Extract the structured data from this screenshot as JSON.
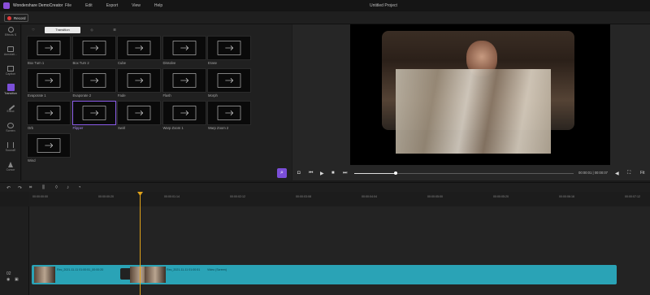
{
  "app": {
    "name": "Wondershare DemoCreator",
    "project_title": "Untitled Project"
  },
  "menu": [
    "File",
    "Edit",
    "Export",
    "View",
    "Help"
  ],
  "record_label": "Record",
  "sidebar": [
    {
      "label": "Effects S",
      "icon": "effects-icon"
    },
    {
      "label": "Annotati...",
      "icon": "annotation-icon"
    },
    {
      "label": "Caption",
      "icon": "caption-icon"
    },
    {
      "label": "Transition",
      "icon": "transition-icon",
      "active": true
    },
    {
      "label": "Effect",
      "icon": "effect-icon"
    },
    {
      "label": "Screen",
      "icon": "screen-icon"
    },
    {
      "label": "SoundE",
      "icon": "sound-icon"
    },
    {
      "label": "Cursor",
      "icon": "cursor-icon"
    }
  ],
  "library_tabs": [
    "",
    "Transition",
    "",
    ""
  ],
  "transitions": [
    "Box Turn 1",
    "Box Turn 2",
    "Cube",
    "Dissolve",
    "Erase",
    "Evaporate 1",
    "Evaporate 2",
    "Fade",
    "Flash",
    "Morph",
    "Orb",
    "Flipper",
    "Swirl",
    "Warp Zoom 1",
    "Warp Zoom 2",
    "Wind"
  ],
  "selected_transition": "Flipper",
  "playback": {
    "timecode": "00:00:01 | 00:00:07",
    "progress": 0.19
  },
  "timeline_ticks": [
    "00:00:00:00",
    "00:00:00:20",
    "00:00:01:14",
    "00:00:02:12",
    "00:00:03:08",
    "00:00:04:04",
    "00:00:05:00",
    "00:00:05:20",
    "00:00:06:16",
    "00:00:07:12"
  ],
  "clip": {
    "label1": "Rec_2021-11-11 01:00:51_00:00:20",
    "label2": "Rec_2021-11-11 01:00:51",
    "label3": "Video (Screen)"
  },
  "colors": {
    "accent": "#7b4fd8",
    "clip": "#2aa3b6",
    "playhead": "#e0a21a"
  }
}
